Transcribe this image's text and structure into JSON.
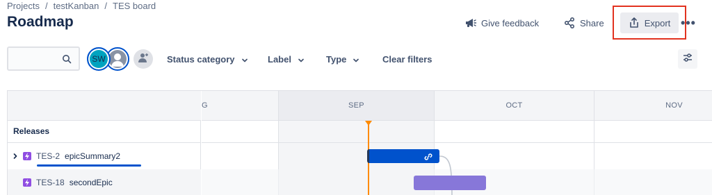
{
  "breadcrumb": {
    "items": [
      "Projects",
      "testKanban",
      "TES board"
    ],
    "separator": "/"
  },
  "page_title": "Roadmap",
  "actions": {
    "give_feedback": "Give feedback",
    "share": "Share",
    "export": "Export",
    "more": "•••"
  },
  "filters": {
    "search_value": "",
    "avatars": [
      {
        "initials": "SW",
        "color": "#00a3bf"
      },
      {
        "initials": "",
        "color": "#8993a4"
      }
    ],
    "status_category": "Status category",
    "label": "Label",
    "type": "Type",
    "clear": "Clear filters"
  },
  "roadmap": {
    "months": [
      "G",
      "SEP",
      "OCT",
      "NOV"
    ],
    "current_month": "SEP",
    "releases_label": "Releases",
    "epics": [
      {
        "key": "TES-2",
        "summary": "epicSummary2",
        "color": "#0052cc"
      },
      {
        "key": "TES-18",
        "summary": "secondEpic",
        "color": "#8777d9"
      }
    ]
  },
  "colors": {
    "accent": "#0052cc",
    "epic_icon": "#904ee2",
    "today": "#ff8b00",
    "highlight_box": "#e2321f"
  },
  "icons": {
    "give_feedback": "megaphone-icon",
    "share": "share-icon",
    "export": "export-icon",
    "search": "search-icon",
    "add_person": "add-person-icon",
    "view_settings": "sliders-icon",
    "epic": "lightning-icon",
    "expand": "chevron-right-icon",
    "link": "link-icon"
  }
}
